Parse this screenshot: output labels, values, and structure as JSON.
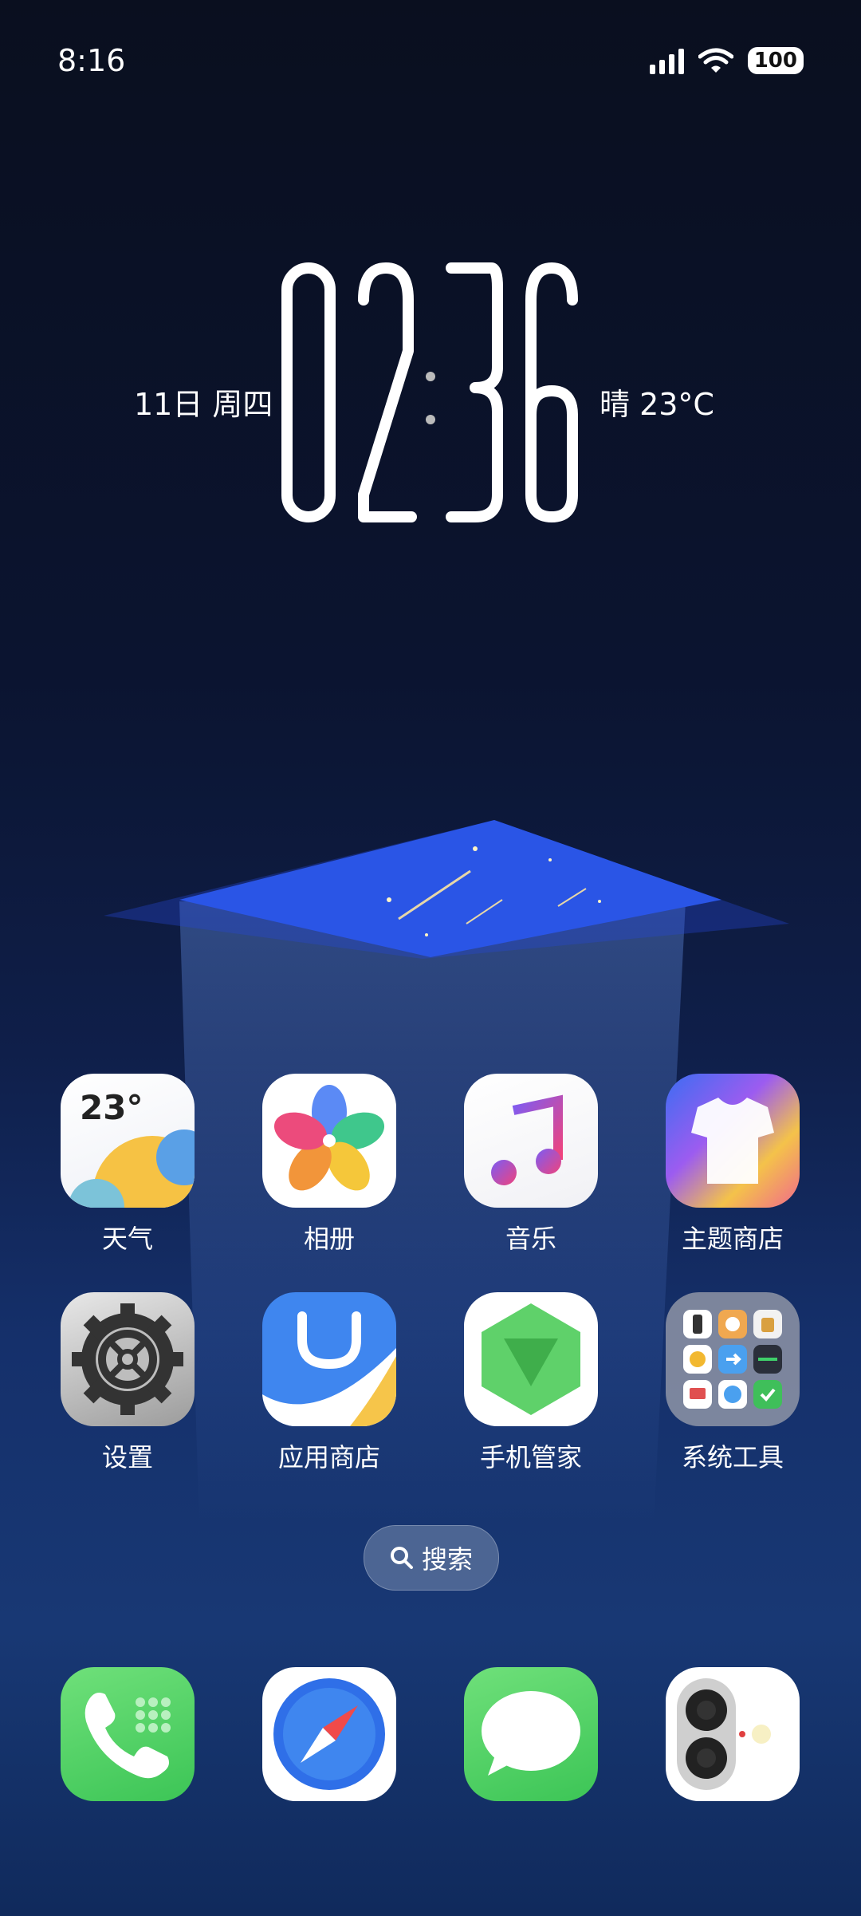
{
  "status_bar": {
    "time": "8:16",
    "battery": "100"
  },
  "clock_widget": {
    "date": "11日 周四",
    "time": "02:36",
    "weather": "晴  23°C"
  },
  "apps": {
    "row1": [
      {
        "label": "天气",
        "icon": "weather-icon",
        "badge": "23°"
      },
      {
        "label": "相册",
        "icon": "gallery-icon"
      },
      {
        "label": "音乐",
        "icon": "music-icon"
      },
      {
        "label": "主题商店",
        "icon": "theme-store-icon"
      }
    ],
    "row2": [
      {
        "label": "设置",
        "icon": "settings-gear-icon"
      },
      {
        "label": "应用商店",
        "icon": "app-store-icon"
      },
      {
        "label": "手机管家",
        "icon": "phone-manager-icon"
      },
      {
        "label": "系统工具",
        "icon": "system-tools-folder-icon"
      }
    ]
  },
  "search": {
    "label": "搜索"
  },
  "dock": [
    {
      "icon": "phone-icon"
    },
    {
      "icon": "browser-compass-icon"
    },
    {
      "icon": "messages-icon"
    },
    {
      "icon": "camera-icon"
    }
  ]
}
